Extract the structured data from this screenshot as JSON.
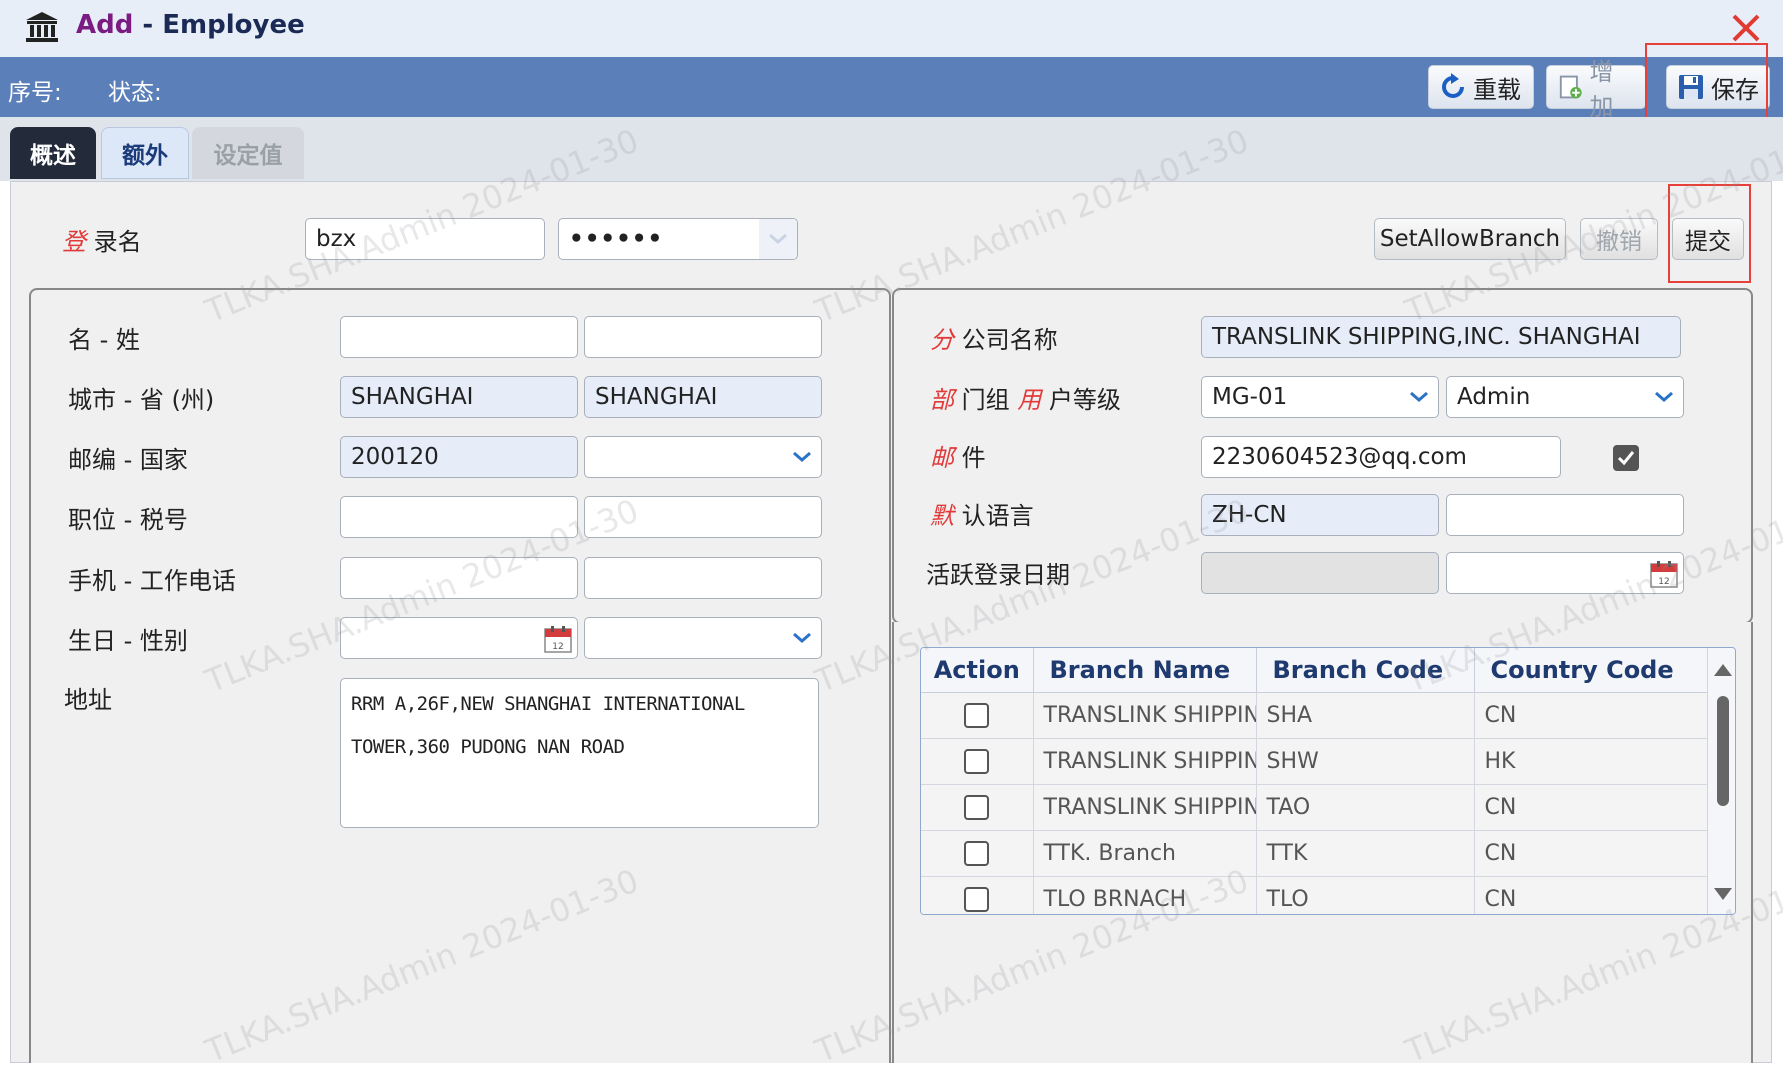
{
  "window": {
    "title_action": "Add",
    "title_sep": " - ",
    "title_entity": "Employee"
  },
  "toolbar": {
    "seq_label": "序号:",
    "status_label": "状态:",
    "reload_label": "重载",
    "add_label": "增加",
    "save_label": "保存"
  },
  "tabs": {
    "overview": "概述",
    "extra": "额外",
    "settings": "设定值"
  },
  "login": {
    "label_req": "登",
    "label_rest": " 录名",
    "username": "bzx",
    "password": "••••••",
    "set_allow_branch": "SetAllowBranch",
    "cancel": "撤销",
    "submit": "提交"
  },
  "left": {
    "name_label": "名 - 姓",
    "city_label": "城市 - 省 (州)",
    "city": "SHANGHAI",
    "province": "SHANGHAI",
    "zip_label": "邮编 - 国家",
    "zip": "200120",
    "position_label": "职位 - 税号",
    "mobile_label": "手机 - 工作电话",
    "birthday_label": "生日 - 性别",
    "address_label": "地址",
    "address_line1": "RRM A,26F,NEW SHANGHAI INTERNATIONAL",
    "address_line2": "TOWER,360 PUDONG NAN ROAD"
  },
  "right": {
    "branch_label_req": "分",
    "branch_label_rest": " 公司名称",
    "branch_name": "TRANSLINK SHIPPING,INC. SHANGHAI",
    "dept_label_req1": "部",
    "dept_label_mid": " 门组 ",
    "dept_label_req2": "用",
    "dept_label_rest": " 户等级",
    "dept": "MG-01",
    "user_level": "Admin",
    "email_label_req": "邮",
    "email_label_rest": " 件",
    "email": "2230604523@qq.com",
    "lang_label_req": "默",
    "lang_label_rest": " 认语言",
    "lang": "ZH-CN",
    "active_label": "活跃登录日期"
  },
  "branch_table": {
    "headers": [
      "Action",
      "Branch Name",
      "Branch Code",
      "Country Code"
    ],
    "rows": [
      {
        "name": "TRANSLINK SHIPPING",
        "code": "SHA",
        "country": "CN"
      },
      {
        "name": "TRANSLINK SHIPPING",
        "code": "SHW",
        "country": "HK"
      },
      {
        "name": "TRANSLINK SHIPPING",
        "code": "TAO",
        "country": "CN"
      },
      {
        "name": "TTK. Branch",
        "code": "TTK",
        "country": "CN"
      },
      {
        "name": "TLO BRNACH",
        "code": "TLO",
        "country": "CN"
      }
    ]
  },
  "watermark": "TLKA.SHA.Admin 2024-01-30",
  "colors": {
    "toolbar": "#5b7fb9",
    "required": "#e03a3a",
    "highlight_box": "#e5403a"
  }
}
